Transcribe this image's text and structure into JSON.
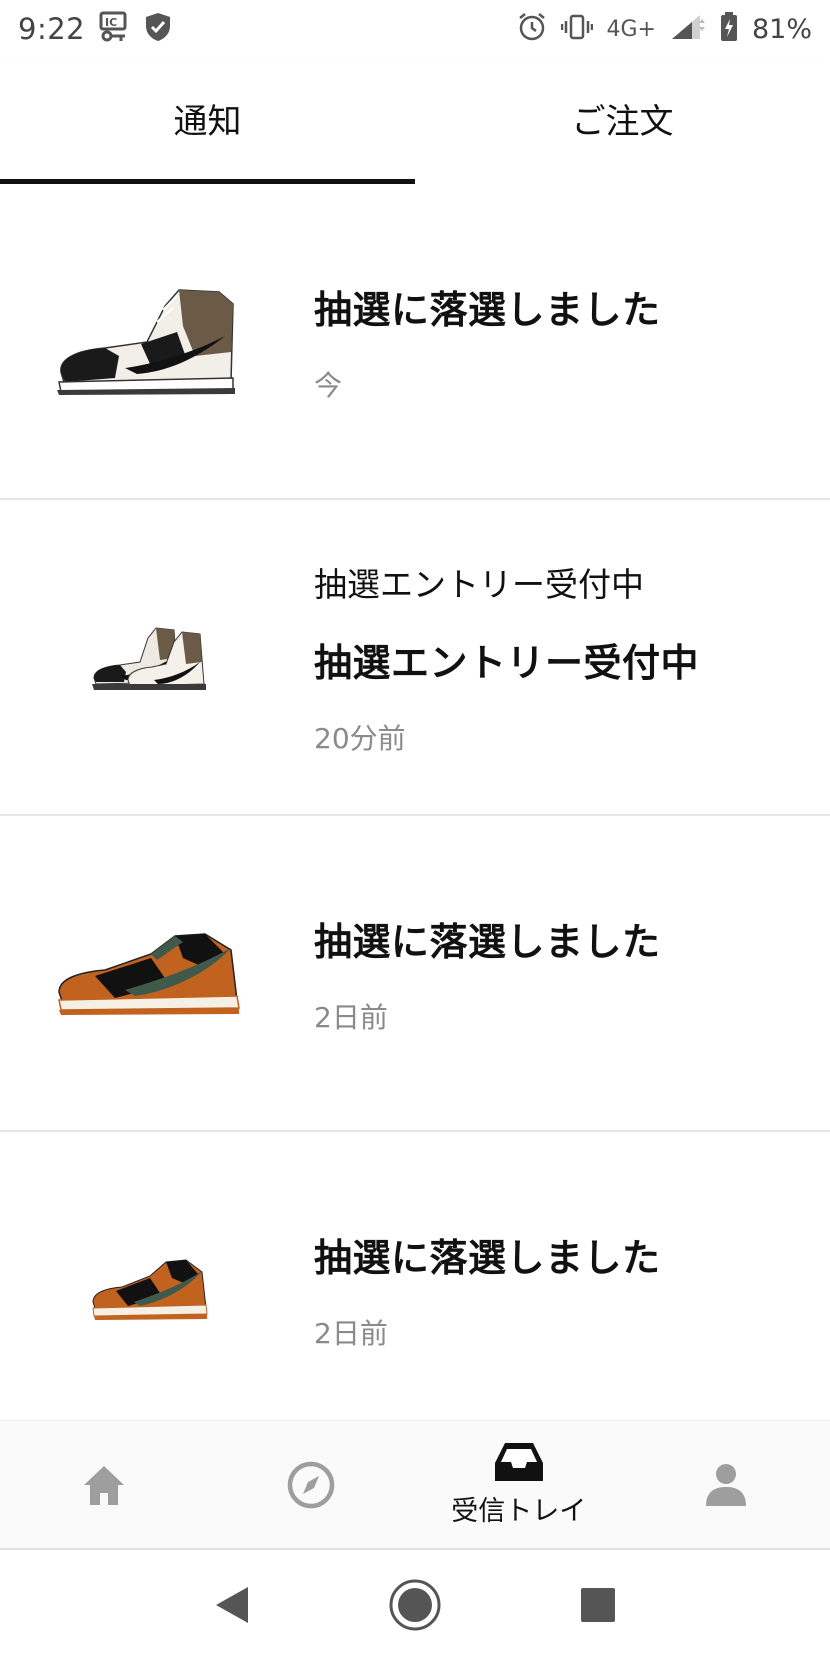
{
  "status_bar": {
    "time": "9:22",
    "network": "4G+",
    "battery": "81%",
    "icons": [
      "ic-key-icon",
      "shield-check-icon",
      "alarm-icon",
      "vibrate-icon",
      "signal-icon",
      "battery-charging-icon"
    ]
  },
  "tabs": [
    {
      "label": "通知",
      "active": true
    },
    {
      "label": "ご注文",
      "active": false
    }
  ],
  "notifications": [
    {
      "subtitle": "",
      "title": "抽選に落選しました",
      "time": "今",
      "thumbnail": "sneaker-high-brown-icon"
    },
    {
      "subtitle": "抽選エントリー受付中",
      "title": "抽選エントリー受付中",
      "time": "20分前",
      "thumbnail": "sneaker-pair-high-icon"
    },
    {
      "subtitle": "",
      "title": "抽選に落選しました",
      "time": "2日前",
      "thumbnail": "sneaker-low-orange-icon"
    },
    {
      "subtitle": "",
      "title": "抽選に落選しました",
      "time": "2日前",
      "thumbnail": "sneaker-low-orange-small-icon"
    }
  ],
  "bottom_nav": {
    "items": [
      {
        "icon": "home-icon",
        "label": ""
      },
      {
        "icon": "compass-icon",
        "label": ""
      },
      {
        "icon": "inbox-icon",
        "label": "受信トレイ",
        "active": true
      },
      {
        "icon": "profile-icon",
        "label": ""
      }
    ]
  },
  "colors": {
    "text": "#111111",
    "muted": "#8a8a8a",
    "inactive_icon": "#9e9e9e",
    "divider": "#e6e6e6"
  }
}
